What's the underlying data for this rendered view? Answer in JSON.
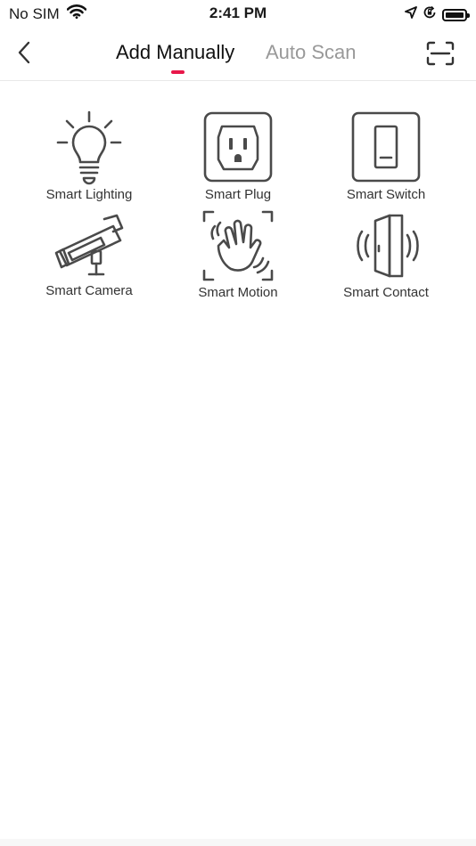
{
  "status_bar": {
    "carrier": "No SIM",
    "time": "2:41 PM"
  },
  "nav": {
    "tabs": [
      {
        "label": "Add Manually",
        "active": true
      },
      {
        "label": "Auto Scan",
        "active": false
      }
    ],
    "accent_color": "#e8174a"
  },
  "devices": [
    {
      "label": "Smart Lighting",
      "icon": "light-bulb-icon"
    },
    {
      "label": "Smart Plug",
      "icon": "plug-icon"
    },
    {
      "label": "Smart Switch",
      "icon": "switch-icon"
    },
    {
      "label": "Smart Camera",
      "icon": "camera-icon"
    },
    {
      "label": "Smart Motion",
      "icon": "motion-hand-icon"
    },
    {
      "label": "Smart Contact",
      "icon": "door-contact-icon"
    }
  ]
}
